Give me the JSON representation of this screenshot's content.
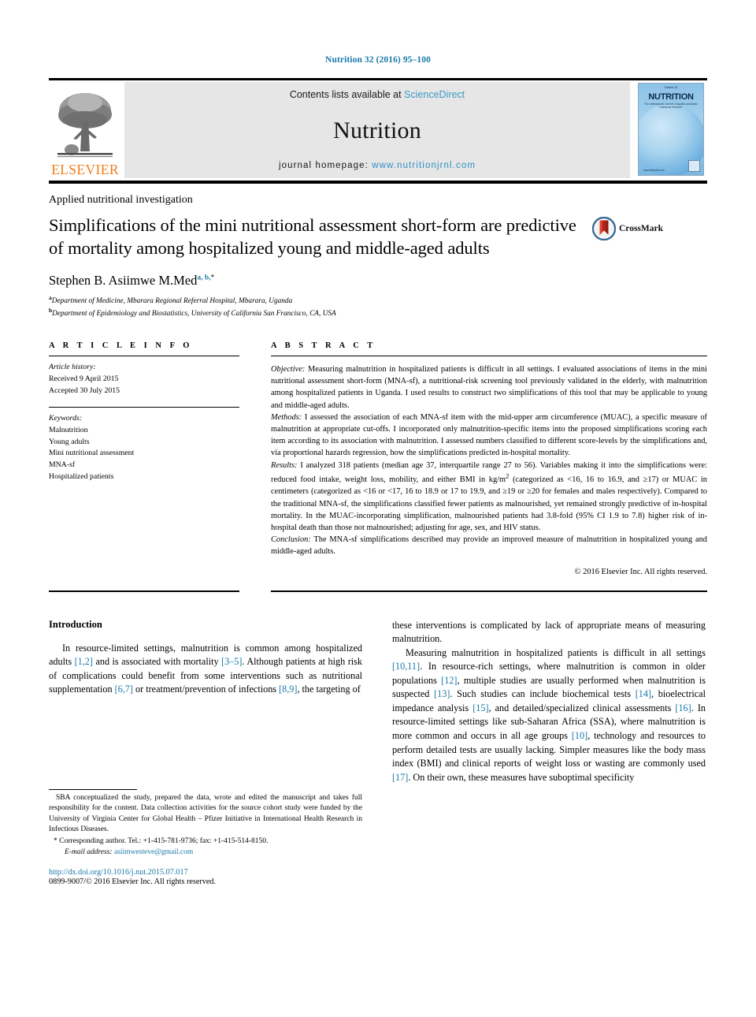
{
  "header": {
    "citation": "Nutrition 32 (2016) 95–100",
    "contents_prefix": "Contents lists available at ",
    "contents_link": "ScienceDirect",
    "journal_name": "Nutrition",
    "homepage_prefix": "journal homepage: ",
    "homepage_url": "www.nutritionjrnl.com",
    "publisher_logo_text": "ELSEVIER",
    "cover": {
      "volume_line": "Volume 32",
      "title": "NUTRITION",
      "subtitle": "The International Journal of Applied and Basic Nutritional Sciences",
      "bottom_word": "www.elsevier.com"
    }
  },
  "article": {
    "kicker": "Applied nutritional investigation",
    "title": "Simplifications of the mini nutritional assessment short-form are predictive of mortality among hospitalized young and middle-aged adults",
    "crossmark_label": "CrossMark",
    "author_name": "Stephen B. Asiimwe M.Med",
    "author_sups": "a, b,",
    "author_star": "*",
    "affiliations": [
      {
        "sup": "a",
        "text": "Department of Medicine, Mbarara Regional Referral Hospital, Mbarara, Uganda"
      },
      {
        "sup": "b",
        "text": "Department of Epidemiology and Biostatistics, University of California San Francisco, CA, USA"
      }
    ]
  },
  "info": {
    "heading": "A R T I C L E  I N F O",
    "history_label": "Article history:",
    "history": [
      "Received 9 April 2015",
      "Accepted 30 July 2015"
    ],
    "keywords_label": "Keywords:",
    "keywords": [
      "Malnutrition",
      "Young adults",
      "Mini nutritional assessment",
      "MNA-sf",
      "Hospitalized patients"
    ]
  },
  "abstract": {
    "heading": "A B S T R A C T",
    "sections": [
      {
        "label": "Objective:",
        "text": " Measuring malnutrition in hospitalized patients is difficult in all settings. I evaluated associations of items in the mini nutritional assessment short-form (MNA-sf), a nutritional-risk screening tool previously validated in the elderly, with malnutrition among hospitalized patients in Uganda. I used results to construct two simplifications of this tool that may be applicable to young and middle-aged adults."
      },
      {
        "label": "Methods:",
        "text": " I assessed the association of each MNA-sf item with the mid-upper arm circumference (MUAC), a specific measure of malnutrition at appropriate cut-offs. I incorporated only malnutrition-specific items into the proposed simplifications scoring each item according to its association with malnutrition. I assessed numbers classified to different score-levels by the simplifications and, via proportional hazards regression, how the simplifications predicted in-hospital mortality."
      },
      {
        "label": "Results:",
        "text": " I analyzed 318 patients (median age 37, interquartile range 27 to 56). Variables making it into the simplifications were: reduced food intake, weight loss, mobility, and either BMI in kg/m2 (categorized as <16, 16 to 16.9, and ≥17) or MUAC in centimeters (categorized as <16 or <17, 16 to 18.9 or 17 to 19.9, and ≥19 or ≥20 for females and males respectively). Compared to the traditional MNA-sf, the simplifications classified fewer patients as malnourished, yet remained strongly predictive of in-hospital mortality. In the MUAC-incorporating simplification, malnourished patients had 3.8-fold (95% CI 1.9 to 7.8) higher risk of in-hospital death than those not malnourished; adjusting for age, sex, and HIV status."
      },
      {
        "label": "Conclusion:",
        "text": " The MNA-sf simplifications described may provide an improved measure of malnutrition in hospitalized young and middle-aged adults."
      }
    ],
    "copyright": "© 2016 Elsevier Inc. All rights reserved."
  },
  "body": {
    "left_heading": "Introduction",
    "left_paragraph": "In resource-limited settings, malnutrition is common among hospitalized adults [1,2] and is associated with mortality [3–5]. Although patients at high risk of complications could benefit from some interventions such as nutritional supplementation [6,7] or treatment/prevention of infections [8,9], the targeting of",
    "right_paragraph_1": "these interventions is complicated by lack of appropriate means of measuring malnutrition.",
    "right_paragraph_2": "Measuring malnutrition in hospitalized patients is difficult in all settings [10,11]. In resource-rich settings, where malnutrition is common in older populations [12], multiple studies are usually performed when malnutrition is suspected [13]. Such studies can include biochemical tests [14], bioelectrical impedance analysis [15], and detailed/specialized clinical assessments [16]. In resource-limited settings like sub-Saharan Africa (SSA), where malnutrition is more common and occurs in all age groups [10], technology and resources to perform detailed tests are usually lacking. Simpler measures like the body mass index (BMI) and clinical reports of weight loss or wasting are commonly used [17]. On their own, these measures have suboptimal specificity"
  },
  "footnotes": {
    "contribution": "SBA conceptualized the study, prepared the data, wrote and edited the manuscript and takes full responsibility for the content. Data collection activities for the source cohort study were funded by the University of Virginia Center for Global Health – Pfizer Initiative in International Health Research in Infectious Diseases.",
    "corresponding": "* Corresponding author. Tel.: +1-415-781-9736; fax: +1-415-514-8150.",
    "email_label": "E-mail address:",
    "email": "asiimwesteve@gmail.com",
    "doi": "http://dx.doi.org/10.1016/j.nut.2015.07.017",
    "issn": "0899-9007/© 2016 Elsevier Inc. All rights reserved."
  },
  "colors": {
    "link": "#1878a8",
    "elsevier_orange": "#f07d1a",
    "masthead_bg": "#e6e6e6"
  }
}
